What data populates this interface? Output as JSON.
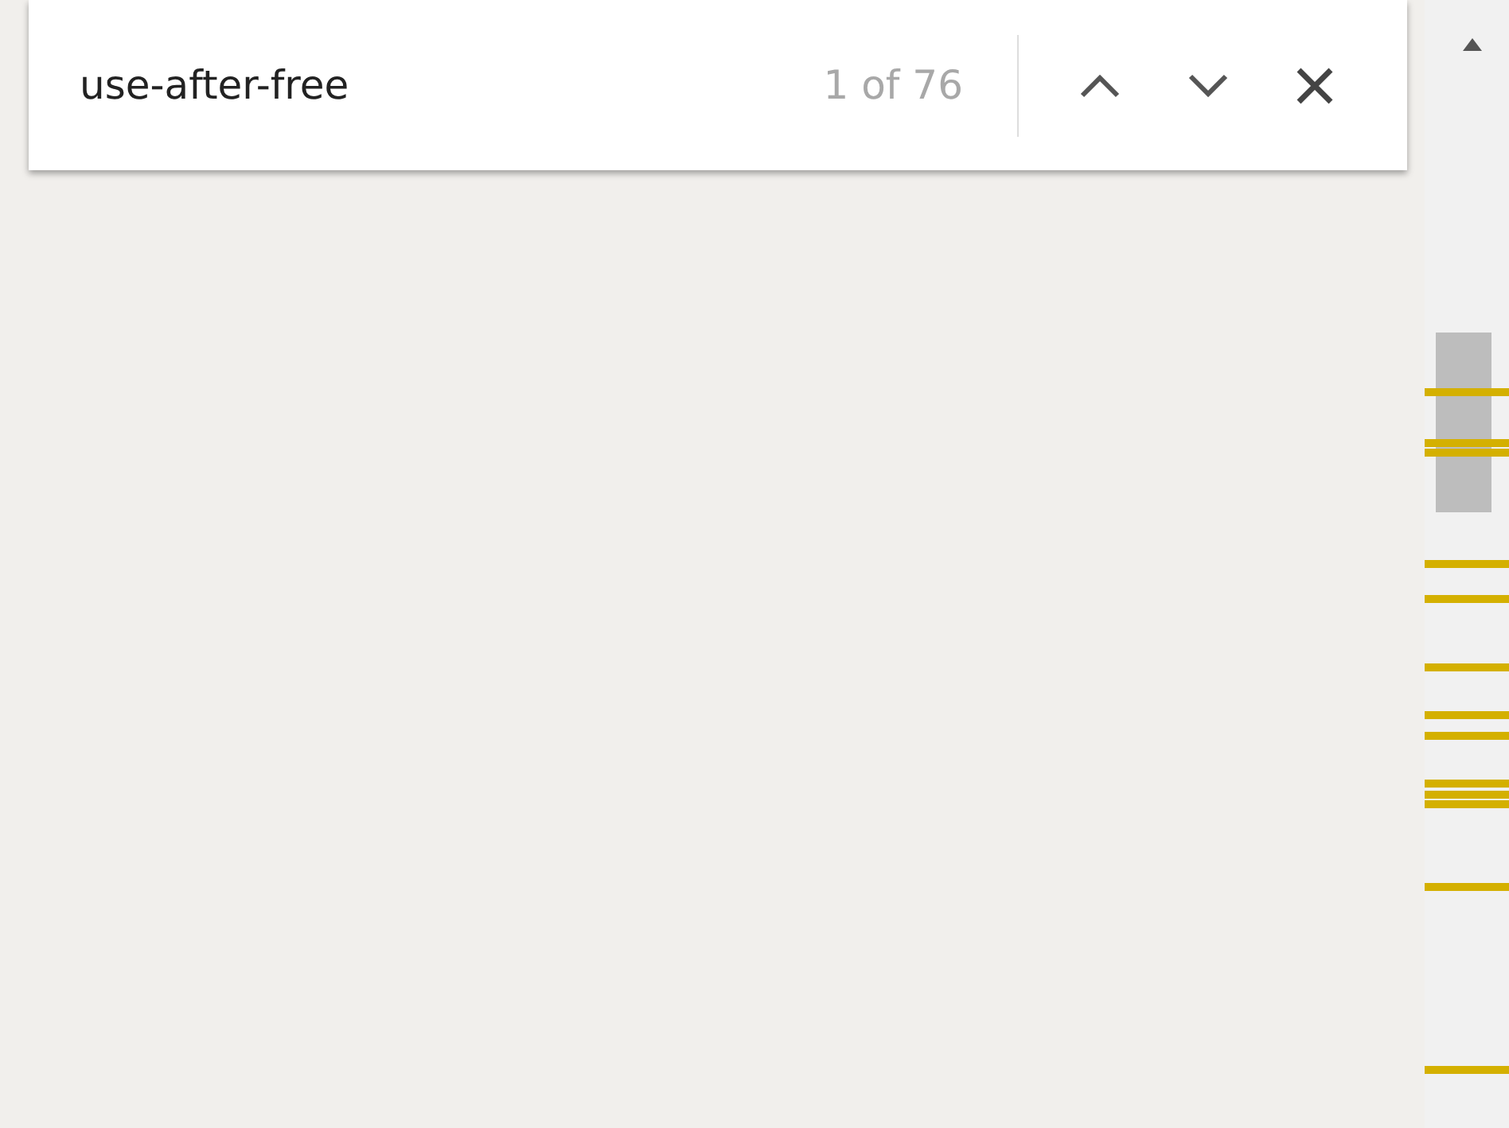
{
  "find_bar": {
    "query": "use-after-free",
    "match_count": "1 of 76"
  }
}
